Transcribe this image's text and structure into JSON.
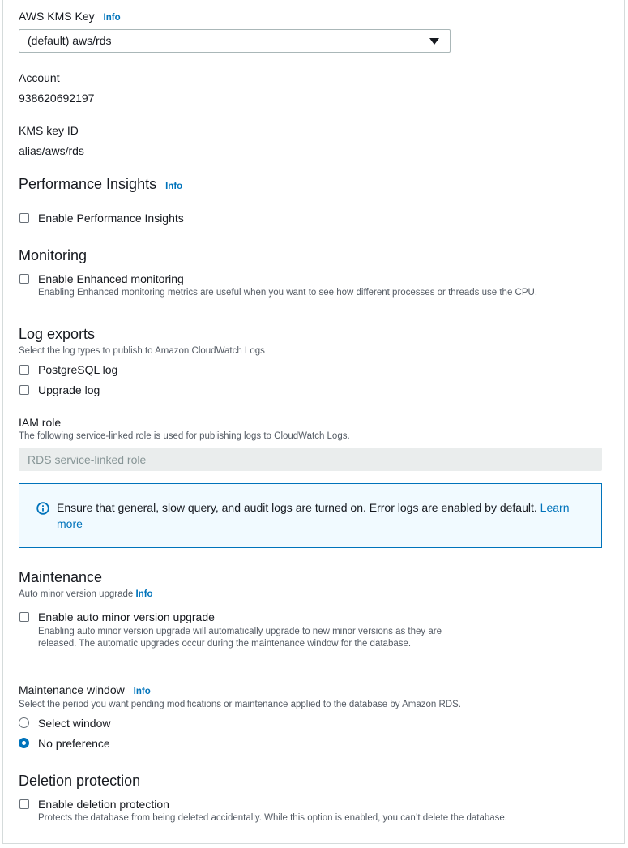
{
  "kms": {
    "label": "AWS KMS Key",
    "info": "Info",
    "selected": "(default) aws/rds",
    "account_label": "Account",
    "account_value": "938620692197",
    "key_id_label": "KMS key ID",
    "key_id_value": "alias/aws/rds"
  },
  "performance": {
    "title": "Performance Insights",
    "info": "Info",
    "enable_label": "Enable Performance Insights",
    "enabled": false
  },
  "monitoring": {
    "title": "Monitoring",
    "enable_label": "Enable Enhanced monitoring",
    "description": "Enabling Enhanced monitoring metrics are useful when you want to see how different processes or threads use the CPU.",
    "enabled": false
  },
  "log_exports": {
    "title": "Log exports",
    "description": "Select the log types to publish to Amazon CloudWatch Logs",
    "options": [
      {
        "label": "PostgreSQL log",
        "checked": false
      },
      {
        "label": "Upgrade log",
        "checked": false
      }
    ],
    "iam_label": "IAM role",
    "iam_description": "The following service-linked role is used for publishing logs to CloudWatch Logs.",
    "iam_value": "RDS service-linked role",
    "alert_text": "Ensure that general, slow query, and audit logs are turned on. Error logs are enabled by default. ",
    "alert_link": "Learn more"
  },
  "maintenance": {
    "title": "Maintenance",
    "auto_label": "Auto minor version upgrade",
    "info": "Info",
    "auto_enable_label": "Enable auto minor version upgrade",
    "auto_description": "Enabling auto minor version upgrade will automatically upgrade to new minor versions as they are released. The automatic upgrades occur during the maintenance window for the database.",
    "auto_enabled": false,
    "window_label": "Maintenance window",
    "window_info": "Info",
    "window_description": "Select the period you want pending modifications or maintenance applied to the database by Amazon RDS.",
    "window_options": [
      {
        "label": "Select window",
        "selected": false
      },
      {
        "label": "No preference",
        "selected": true
      }
    ]
  },
  "deletion": {
    "title": "Deletion protection",
    "enable_label": "Enable deletion protection",
    "description": "Protects the database from being deleted accidentally. While this option is enabled, you can’t delete the database.",
    "enabled": false
  },
  "colors": {
    "accent": "#0073bb",
    "alert_bg": "#f1faff",
    "disabled_bg": "#eaeded"
  }
}
